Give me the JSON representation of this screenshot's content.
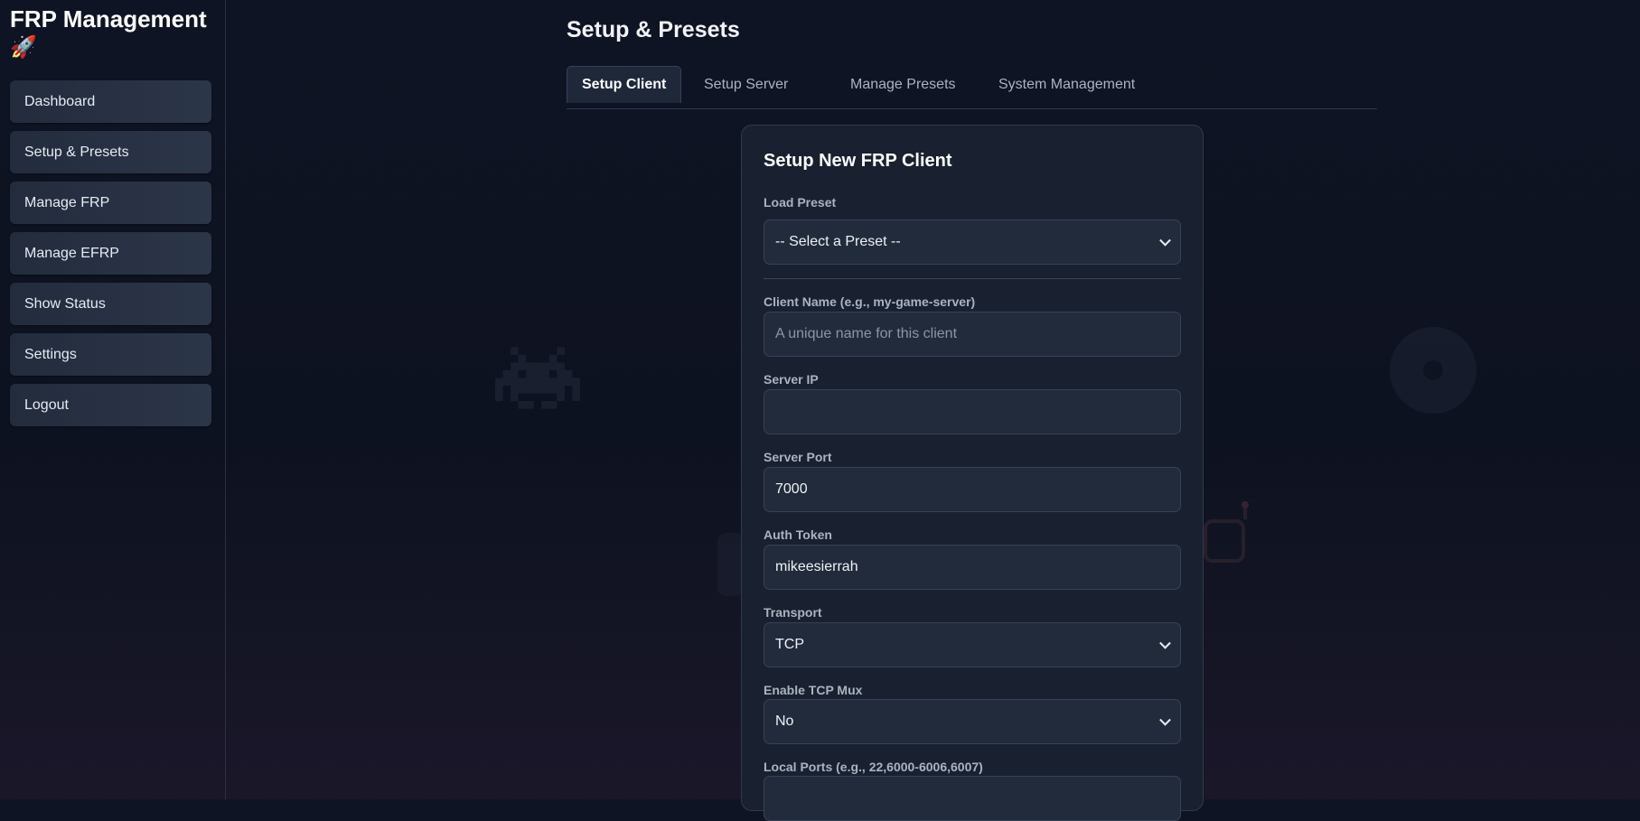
{
  "app": {
    "title": "FRP Management",
    "logo_emoji": "🚀"
  },
  "sidebar": {
    "items": [
      {
        "label": "Dashboard"
      },
      {
        "label": "Setup & Presets"
      },
      {
        "label": "Manage FRP"
      },
      {
        "label": "Manage EFRP"
      },
      {
        "label": "Show Status"
      },
      {
        "label": "Settings"
      },
      {
        "label": "Logout"
      }
    ]
  },
  "page": {
    "title": "Setup & Presets"
  },
  "tabs": [
    {
      "label": "Setup Client",
      "active": true
    },
    {
      "label": "Setup Server",
      "active": false
    },
    {
      "label": "Manage Presets",
      "active": false
    },
    {
      "label": "System Management",
      "active": false
    }
  ],
  "form": {
    "title": "Setup New FRP Client",
    "load_preset": {
      "label": "Load Preset",
      "value": "-- Select a Preset --"
    },
    "client_name": {
      "label": "Client Name (e.g., my-game-server)",
      "placeholder": "A unique name for this client",
      "value": ""
    },
    "server_ip": {
      "label": "Server IP",
      "value": ""
    },
    "server_port": {
      "label": "Server Port",
      "value": "7000"
    },
    "auth_token": {
      "label": "Auth Token",
      "value": "mikeesierrah"
    },
    "transport": {
      "label": "Transport",
      "value": "TCP"
    },
    "tcp_mux": {
      "label": "Enable TCP Mux",
      "value": "No"
    },
    "local_ports": {
      "label": "Local Ports (e.g., 22,6000-6006,6007)",
      "value": ""
    }
  },
  "decorations": [
    "space-invader-icon",
    "vinyl-disc-icon",
    "robot-icon",
    "gamepad-icon"
  ]
}
